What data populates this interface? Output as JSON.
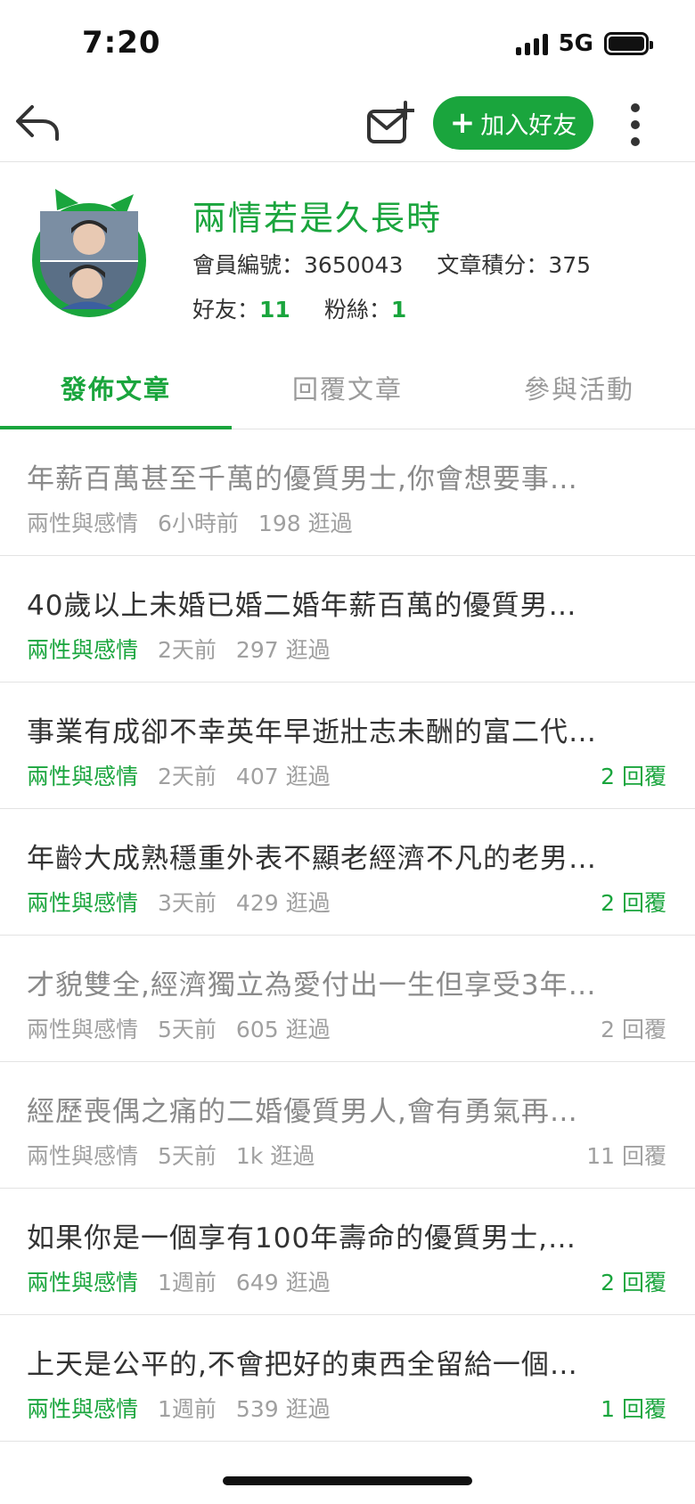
{
  "status_bar": {
    "time": "7:20",
    "network": "5G"
  },
  "nav": {
    "add_friend_label": "加入好友"
  },
  "profile": {
    "name": "兩情若是久長時",
    "member_id_label": "會員編號：",
    "member_id": "3650043",
    "score_label": "文章積分：",
    "score": "375",
    "friends_label": "好友：",
    "friends": "11",
    "fans_label": "粉絲：",
    "fans": "1"
  },
  "tabs": [
    {
      "label": "發佈文章",
      "active": true
    },
    {
      "label": "回覆文章",
      "active": false
    },
    {
      "label": "參與活動",
      "active": false
    }
  ],
  "posts": [
    {
      "title": "年薪百萬甚至千萬的優質男士,你會想要事…",
      "category": "兩性與感情",
      "time": "6小時前",
      "views": "198 逛過",
      "replies": "",
      "read": true
    },
    {
      "title": "40歲以上未婚已婚二婚年薪百萬的優質男…",
      "category": "兩性與感情",
      "time": "2天前",
      "views": "297 逛過",
      "replies": "",
      "read": false
    },
    {
      "title": "事業有成卻不幸英年早逝壯志未酬的富二代…",
      "category": "兩性與感情",
      "time": "2天前",
      "views": "407 逛過",
      "replies": "2 回覆",
      "read": false
    },
    {
      "title": "年齡大成熟穩重外表不顯老經濟不凡的老男…",
      "category": "兩性與感情",
      "time": "3天前",
      "views": "429 逛過",
      "replies": "2 回覆",
      "read": false
    },
    {
      "title": "才貌雙全,經濟獨立為愛付出一生但享受3年…",
      "category": "兩性與感情",
      "time": "5天前",
      "views": "605 逛過",
      "replies": "2 回覆",
      "read": true
    },
    {
      "title": "經歷喪偶之痛的二婚優質男人,會有勇氣再…",
      "category": "兩性與感情",
      "time": "5天前",
      "views": "1k 逛過",
      "replies": "11 回覆",
      "read": true
    },
    {
      "title": "如果你是一個享有100年壽命的優質男士,…",
      "category": "兩性與感情",
      "time": "1週前",
      "views": "649 逛過",
      "replies": "2 回覆",
      "read": false
    },
    {
      "title": "上天是公平的,不會把好的東西全留給一個…",
      "category": "兩性與感情",
      "time": "1週前",
      "views": "539 逛過",
      "replies": "1 回覆",
      "read": false
    }
  ],
  "colors": {
    "accent": "#1aa53d",
    "text": "#333333",
    "muted": "#a0a0a0"
  },
  "icons": [
    "back-arrow-icon",
    "mail-plus-icon",
    "plus-icon",
    "more-vertical-icon",
    "avatar-cat-frame-icon"
  ]
}
